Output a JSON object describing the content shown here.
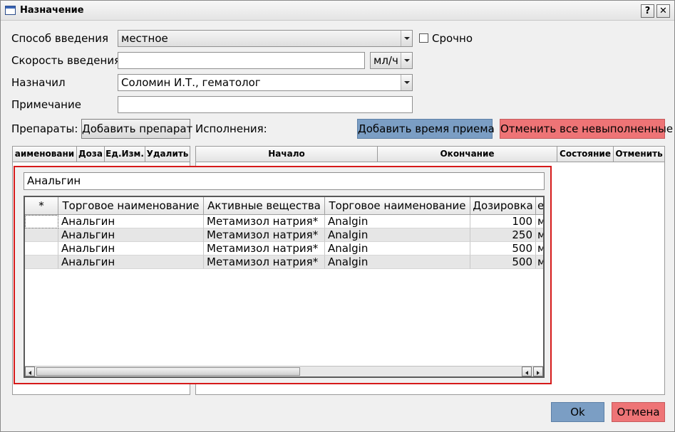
{
  "window": {
    "title": "Назначение",
    "help_glyph": "?",
    "close_glyph": "✕"
  },
  "form": {
    "route_label": "Способ введения",
    "route_value": "местное",
    "urgent_label": "Срочно",
    "speed_label": "Скорость введения",
    "speed_value": "",
    "speed_unit": "мл/ч",
    "prescriber_label": "Назначил",
    "prescriber_value": "Соломин И.Т., гематолог",
    "note_label": "Примечание",
    "note_value": ""
  },
  "toolbar": {
    "drugs_label": "Препараты:",
    "add_drug": "Добавить препарат",
    "executions_label": "Исполнения:",
    "add_time": "Добавить время приема",
    "cancel_all": "Отменить все невыполненные"
  },
  "drug_table": {
    "headers": [
      "аименовани",
      "Доза",
      "Ед.Изм.",
      "Удалить"
    ]
  },
  "exec_table": {
    "headers": [
      "Начало",
      "Окончание",
      "Состояние",
      "Отменить"
    ]
  },
  "search_popup": {
    "query": "Анальгин",
    "headers": [
      "*",
      "Торговое наименование",
      "Активные вещества",
      "Торговое наименование",
      "Дозировка",
      "е"
    ],
    "rows": [
      [
        "",
        "Анальгин",
        "Метамизол натрия*",
        "Analgin",
        "100",
        "м"
      ],
      [
        "",
        "Анальгин",
        "Метамизол натрия*",
        "Analgin",
        "250",
        "м"
      ],
      [
        "",
        "Анальгин",
        "Метамизол натрия*",
        "Analgin",
        "500",
        "м"
      ],
      [
        "",
        "Анальгин",
        "Метамизол натрия*",
        "Analgin",
        "500",
        "м"
      ]
    ]
  },
  "footer": {
    "ok": "Ok",
    "cancel": "Отмена"
  },
  "colors": {
    "accent_blue": "#7b9ec4",
    "accent_red": "#ee7476",
    "popup_border": "#d61a1a"
  }
}
